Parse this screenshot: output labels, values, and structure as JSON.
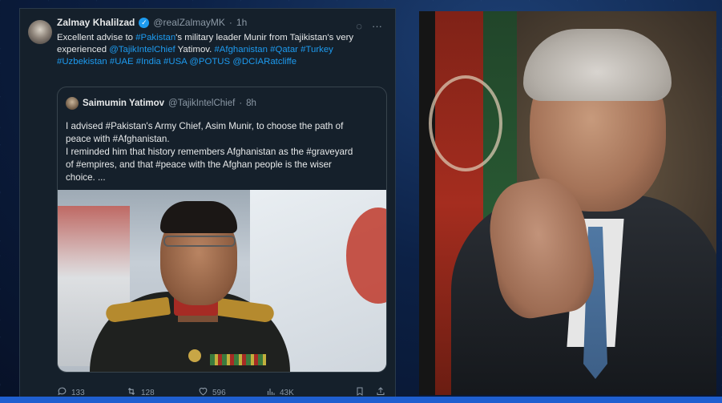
{
  "tweet": {
    "author_name": "Zalmay Khalilzad",
    "author_handle": "@realZalmayMK",
    "separator": "·",
    "time": "1h",
    "body_segments": [
      {
        "text": "Excellent advise to ",
        "link": false
      },
      {
        "text": "#Pakistan",
        "link": true
      },
      {
        "text": "'s military leader Munir from Tajikistan's very experienced ",
        "link": false
      },
      {
        "text": "@TajikIntelChief",
        "link": true
      },
      {
        "text": " Yatimov. ",
        "link": false
      },
      {
        "text": "#Afghanistan",
        "link": true
      },
      {
        "text": " ",
        "link": false
      },
      {
        "text": "#Qatar",
        "link": true
      },
      {
        "text": " ",
        "link": false
      },
      {
        "text": "#Turkey",
        "link": true
      },
      {
        "text": " ",
        "link": false
      },
      {
        "text": "#Uzbekistan",
        "link": true
      },
      {
        "text": " ",
        "link": false
      },
      {
        "text": "#UAE",
        "link": true
      },
      {
        "text": " ",
        "link": false
      },
      {
        "text": "#India",
        "link": true
      },
      {
        "text": " ",
        "link": false
      },
      {
        "text": "#USA",
        "link": true
      },
      {
        "text": " ",
        "link": false
      },
      {
        "text": "@POTUS",
        "link": true
      },
      {
        "text": " ",
        "link": false
      },
      {
        "text": "@DCIARatcliffe",
        "link": true
      }
    ],
    "icons": {
      "verified": "verified-badge-icon",
      "grok": "grok-icon",
      "more": "more-options-icon"
    },
    "quote": {
      "author_name": "Saimumin Yatimov",
      "author_handle": "@TajikIntelChief",
      "separator": "·",
      "time": "8h",
      "text_lines": [
        "I advised #Pakistan's Army Chief, Asim Munir, to choose the path of",
        "peace with #Afghanistan.",
        "I reminded him that history remembers Afghanistan as the #graveyard",
        "of #empires, and that #peace with the Afghan people is the wiser",
        "choice.  ..."
      ]
    },
    "actions": {
      "replies": "133",
      "reposts": "128",
      "likes": "596",
      "views": "43K"
    }
  },
  "colors": {
    "panel_bg": "#15202b",
    "link": "#1d9bf0",
    "muted": "#8b98a5",
    "accent_bar": "#1f5fd0"
  }
}
